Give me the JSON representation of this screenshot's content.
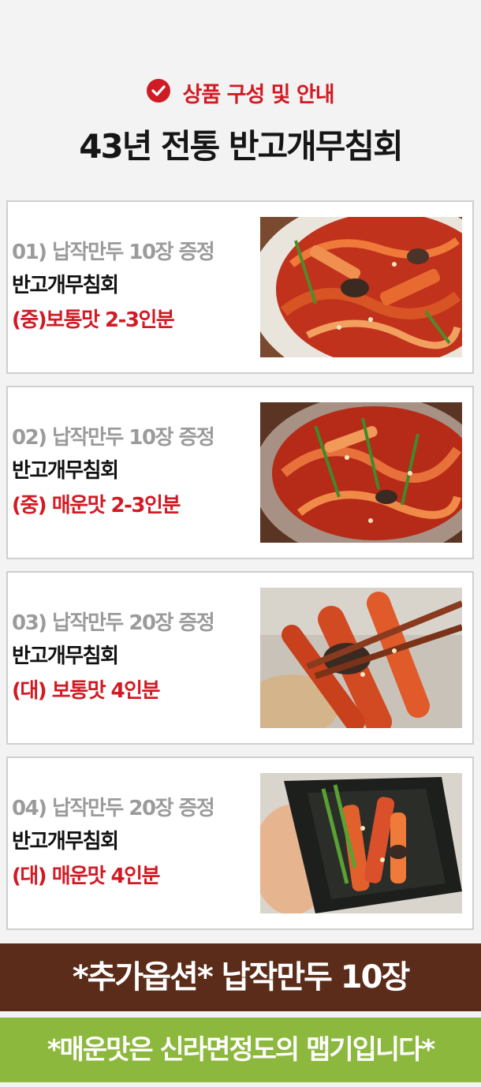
{
  "header": {
    "subtitle": "상품 구성 및 안내",
    "title": "43년 전통 반고개무침회"
  },
  "products": [
    {
      "gift": "01) 납작만두 10장 증정",
      "name": "반고개무침회",
      "option": "(중)보통맛 2-3인분",
      "photo": "spicy-salad-bowl"
    },
    {
      "gift": "02) 납작만두 10장 증정",
      "name": "반고개무침회",
      "option": "(중) 매운맛 2-3인분",
      "photo": "spicy-salad-glass-bowl"
    },
    {
      "gift": "03) 납작만두 20장 증정",
      "name": "반고개무침회",
      "option": "(대) 보통맛 4인분",
      "photo": "chopsticks-bite"
    },
    {
      "gift": "04) 납작만두 20장 증정",
      "name": "반고개무침회",
      "option": "(대) 매운맛 4인분",
      "photo": "seaweed-wrap"
    }
  ],
  "banners": {
    "extra_option": "*추가옵션*  납작만두 10장",
    "spicy_note": "*매운맛은 신라면정도의 맵기입니다*"
  },
  "colors": {
    "accent_red": "#d11b24",
    "banner_brown": "#5b2c1a",
    "banner_green": "#8db83e"
  }
}
